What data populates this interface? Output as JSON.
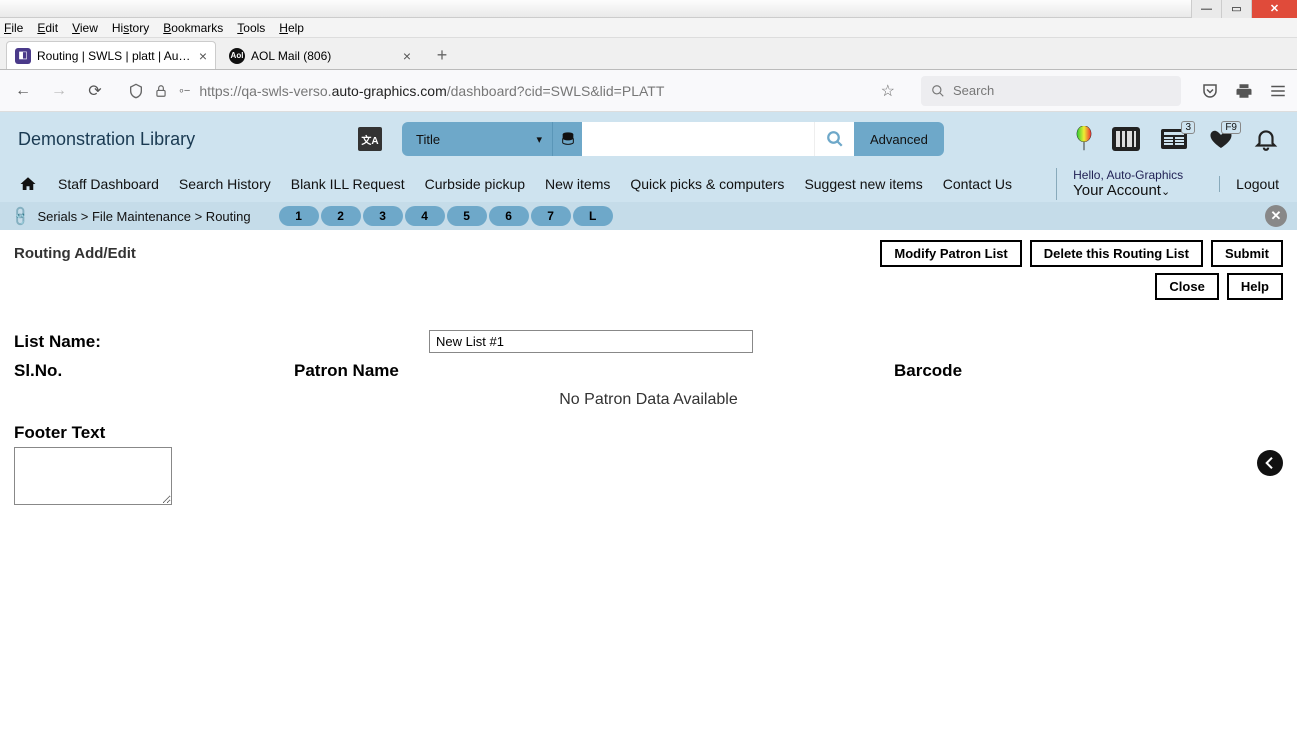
{
  "os_menu": [
    "File",
    "Edit",
    "View",
    "History",
    "Bookmarks",
    "Tools",
    "Help"
  ],
  "tabs": [
    {
      "label": "Routing | SWLS | platt | Auto-Gr"
    },
    {
      "label": "AOL Mail (806)"
    }
  ],
  "url": {
    "pre": "https://qa-swls-verso.",
    "bold": "auto-graphics.com",
    "post": "/dashboard?cid=SWLS&lid=PLATT"
  },
  "search_placeholder": "Search",
  "library_name": "Demonstration Library",
  "search_type": "Title",
  "advanced": "Advanced",
  "badges": {
    "news": "3",
    "fav": "F9"
  },
  "nav": [
    "Staff Dashboard",
    "Search History",
    "Blank ILL Request",
    "Curbside pickup",
    "New items",
    "Quick picks & computers",
    "Suggest new items",
    "Contact Us"
  ],
  "hello": "Hello, Auto-Graphics",
  "your_account": "Your Account",
  "logout": "Logout",
  "breadcrumb": "Serials > File Maintenance > Routing",
  "steps": [
    "1",
    "2",
    "3",
    "4",
    "5",
    "6",
    "7",
    "L"
  ],
  "page_title": "Routing Add/Edit",
  "buttons": {
    "modify": "Modify Patron List",
    "delete": "Delete this Routing List",
    "submit": "Submit",
    "close": "Close",
    "help": "Help"
  },
  "list_name_label": "List Name:",
  "list_name_value": "New List #1",
  "cols": {
    "slno": "Sl.No.",
    "patron": "Patron Name",
    "barcode": "Barcode"
  },
  "no_data": "No Patron Data Available",
  "footer_label": "Footer Text",
  "footer_value": ""
}
